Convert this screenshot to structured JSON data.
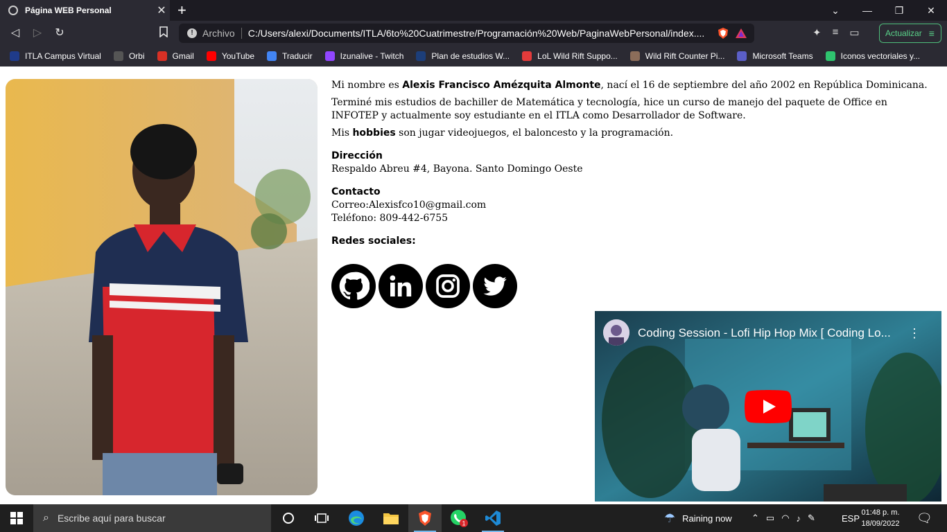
{
  "browser": {
    "tab_title": "Página WEB Personal",
    "tab_close": "✕",
    "new_tab": "+",
    "url_scheme": "Archivo",
    "url": "C:/Users/alexi/Documents/ITLA/6to%20Cuatrimestre/Programación%20Web/PaginaWebPersonal/index....",
    "update_label": "Actualizar",
    "bookmarks": [
      {
        "label": "ITLA Campus Virtual",
        "color": "#1f3b8a"
      },
      {
        "label": "Orbi",
        "color": "#555555"
      },
      {
        "label": "Gmail",
        "color": "#d93025"
      },
      {
        "label": "YouTube",
        "color": "#ff0000"
      },
      {
        "label": "Traducir",
        "color": "#4285f4"
      },
      {
        "label": "Izunalive - Twitch",
        "color": "#9146ff"
      },
      {
        "label": "Plan de estudios W...",
        "color": "#1c3e7a"
      },
      {
        "label": "LoL Wild Rift Suppo...",
        "color": "#e33b3b"
      },
      {
        "label": "Wild Rift Counter Pi...",
        "color": "#8c6d5a"
      },
      {
        "label": "Microsoft Teams",
        "color": "#5b5fc7"
      },
      {
        "label": "Iconos vectoriales y...",
        "color": "#2fc46f"
      }
    ]
  },
  "profile": {
    "intro_prefix": "Mi nombre es ",
    "name": "Alexis Francisco Amézquita Almonte",
    "intro_suffix": ", nací el 16 de septiembre del año 2002 en República Dominicana.",
    "studies": "Terminé mis estudios de bachiller de Matemática y tecnología, hice un curso de manejo del paquete de Office en INFOTEP y actualmente soy estudiante en el ITLA como Desarrollador de Software.",
    "hobbies_prefix": "Mis ",
    "hobbies_word": "hobbies",
    "hobbies_suffix": " son jugar videojuegos, el baloncesto y la programación.",
    "address_label": "Dirección",
    "address": "Respaldo Abreu #4, Bayona. Santo Domingo Oeste",
    "contact_label": "Contacto",
    "email": "Correo:Alexisfco10@gmail.com",
    "phone": "Teléfono: 809-442-6755",
    "social_label": "Redes sociales:",
    "social_icons": [
      "github-icon",
      "linkedin-icon",
      "instagram-icon",
      "twitter-icon"
    ]
  },
  "video": {
    "title": "Coding Session - Lofi Hip Hop Mix [ Coding Lo...",
    "menu": "⋮"
  },
  "taskbar": {
    "search_placeholder": "Escribe aquí para buscar",
    "weather": "Raining now",
    "lang": "ESP",
    "time": "01:48 p. m.",
    "date": "18/09/2022",
    "whatsapp_badge": "1"
  }
}
